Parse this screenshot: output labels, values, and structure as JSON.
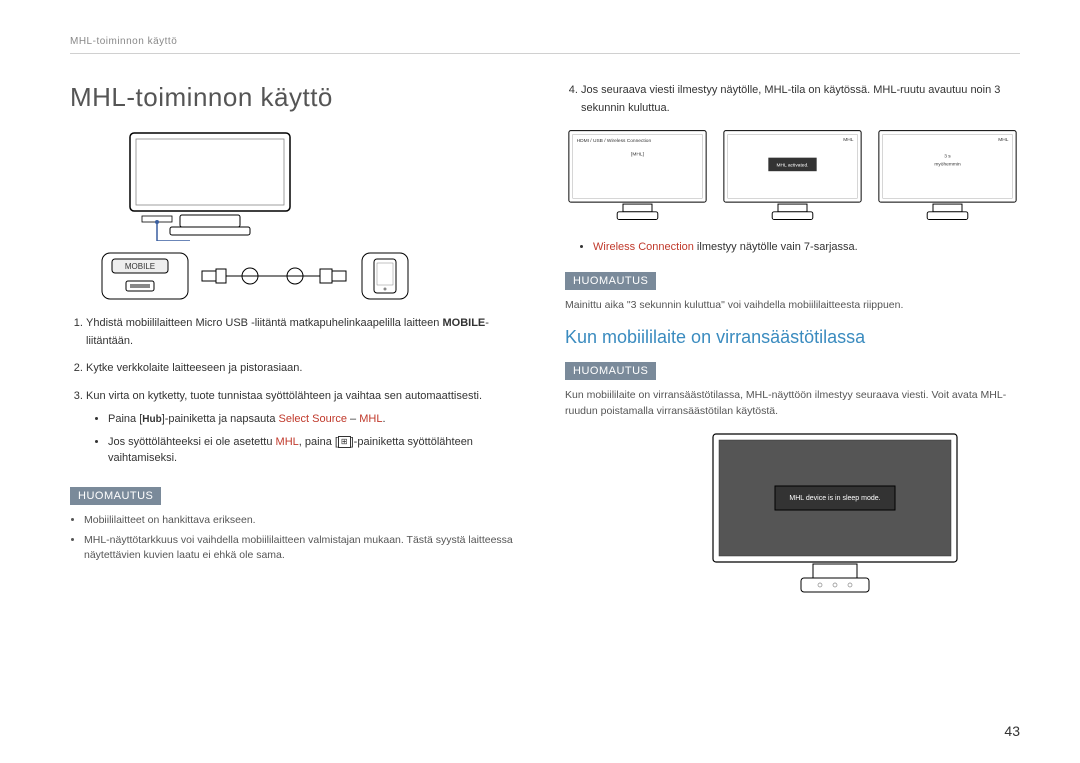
{
  "header": {
    "breadcrumb": "MHL-toiminnon käyttö"
  },
  "title": "MHL-toiminnon käyttö",
  "fig": {
    "port_label": "MOBILE",
    "mon_a_label": "HDMI / USB / Wireless Connection",
    "mon_a_sub": "[MHL]",
    "mon_b_top": "MHL",
    "mon_b_msg": "MHL activated.",
    "mon_c_top": "MHL",
    "mon_c_msg1": "3 s",
    "mon_c_msg2": "myöhemmin",
    "sleep_msg": "MHL device is in sleep mode."
  },
  "steps": [
    {
      "text_a": "Yhdistä mobiililaitteen Micro USB -liitäntä matkapuhelinkaapelilla laitteen ",
      "bold": "MOBILE",
      "text_b": "-liitäntään."
    },
    {
      "text_a": "Kytke verkkolaite laitteeseen ja pistorasiaan."
    },
    {
      "text_a": "Kun virta on kytketty, tuote tunnistaa syöttölähteen ja vaihtaa sen automaattisesti."
    }
  ],
  "sub_bullets": {
    "a_pre": "Paina [",
    "a_hub": "Hub",
    "a_mid": "]-painiketta ja napsauta ",
    "a_sel": "Select Source",
    "a_dash": " – ",
    "a_mhl": "MHL",
    "a_post": ".",
    "b_pre": "Jos syöttölähteeksi ei ole asetettu ",
    "b_mhl": "MHL",
    "b_mid": ", paina [",
    "b_post": "]-painiketta syöttölähteen vaihtamiseksi."
  },
  "note_label": "HUOMAUTUS",
  "left_notes": [
    "Mobiililaitteet on hankittava erikseen.",
    "MHL-näyttötarkkuus voi vaihdella mobiililaitteen valmistajan mukaan. Tästä syystä laitteessa näytettävien kuvien laatu ei ehkä ole sama."
  ],
  "right": {
    "step4_a": "Jos seuraava viesti ilmestyy näytölle, MHL-tila on käytössä. MHL-ruutu avautuu noin 3 sekunnin kuluttua.",
    "wc_bullet_a": "Wireless Connection",
    "wc_bullet_b": " ilmestyy näytölle vain 7-sarjassa.",
    "note1": "Mainittu aika \"3 sekunnin kuluttua\" voi vaihdella mobiililaitteesta riippuen.",
    "subtitle": "Kun mobiililaite on virransäästötilassa",
    "note2": "Kun mobiililaite on virransäästötilassa, MHL-näyttöön ilmestyy seuraava viesti. Voit avata MHL-ruudun poistamalla virransäästötilan käytöstä."
  },
  "page_number": "43"
}
